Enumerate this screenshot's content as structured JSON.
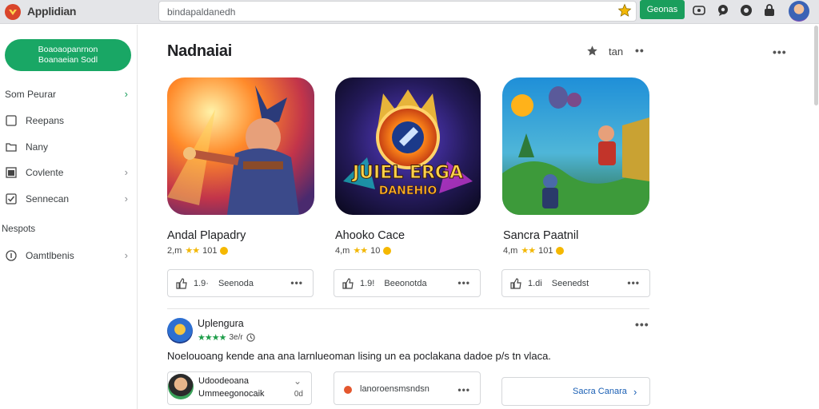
{
  "app": {
    "name": "Applidian"
  },
  "search": {
    "value": "bindapaldanedh"
  },
  "topbar": {
    "games_label": "Geonas"
  },
  "sidebar": {
    "new_button_line1": "Boaoaopanrnon",
    "new_button_line2": "Boanaeian Sodl",
    "items": [
      {
        "label": "Som Peurar",
        "icon": "none",
        "chevron": "›"
      },
      {
        "label": "Reepans",
        "icon": "square-icon"
      },
      {
        "label": "Nany",
        "icon": "folder-icon"
      },
      {
        "label": "Covlente",
        "icon": "window-icon",
        "chevron": "›"
      },
      {
        "label": "Sennecan",
        "icon": "check-icon",
        "chevron": "›"
      }
    ],
    "section_label": "Nespots",
    "section_items": [
      {
        "label": "Oamtlbenis",
        "icon": "info-icon",
        "chevron": "›"
      }
    ]
  },
  "main": {
    "title": "Nadnaiai",
    "header_label": "tan",
    "cards": [
      {
        "title": "Andal Plapadry",
        "rating": "2,m",
        "reviews": "101",
        "likes": "1.9·",
        "action_label": "Seenoda"
      },
      {
        "title": "Ahooko Cace",
        "rating": "4,m",
        "reviews": "10",
        "likes": "1.9!",
        "action_label": "Beeonotda",
        "art_line1": "JUIEL ERGA",
        "art_line2": "DANEHIO"
      },
      {
        "title": "Sancra Paatnil",
        "rating": "4,m",
        "reviews": "101",
        "likes": "1.di",
        "action_label": "Seenedst"
      }
    ],
    "review": {
      "author": "Uplengura",
      "time": "3e/r",
      "text": "Noelouoang kende ana ana larnlueoman lising un ea poclakana dadoe p/s tn vlaca."
    },
    "sub_cards": [
      {
        "line1": "Udoodeoana",
        "line2": "Ummeegonocaik",
        "ago": "0d"
      },
      {
        "text": "lanoroensmsndsn"
      }
    ],
    "more_link": "Sacra Canara"
  },
  "colors": {
    "accent": "#19a765",
    "star": "#f2b705",
    "green_star": "#1e9e4a"
  }
}
